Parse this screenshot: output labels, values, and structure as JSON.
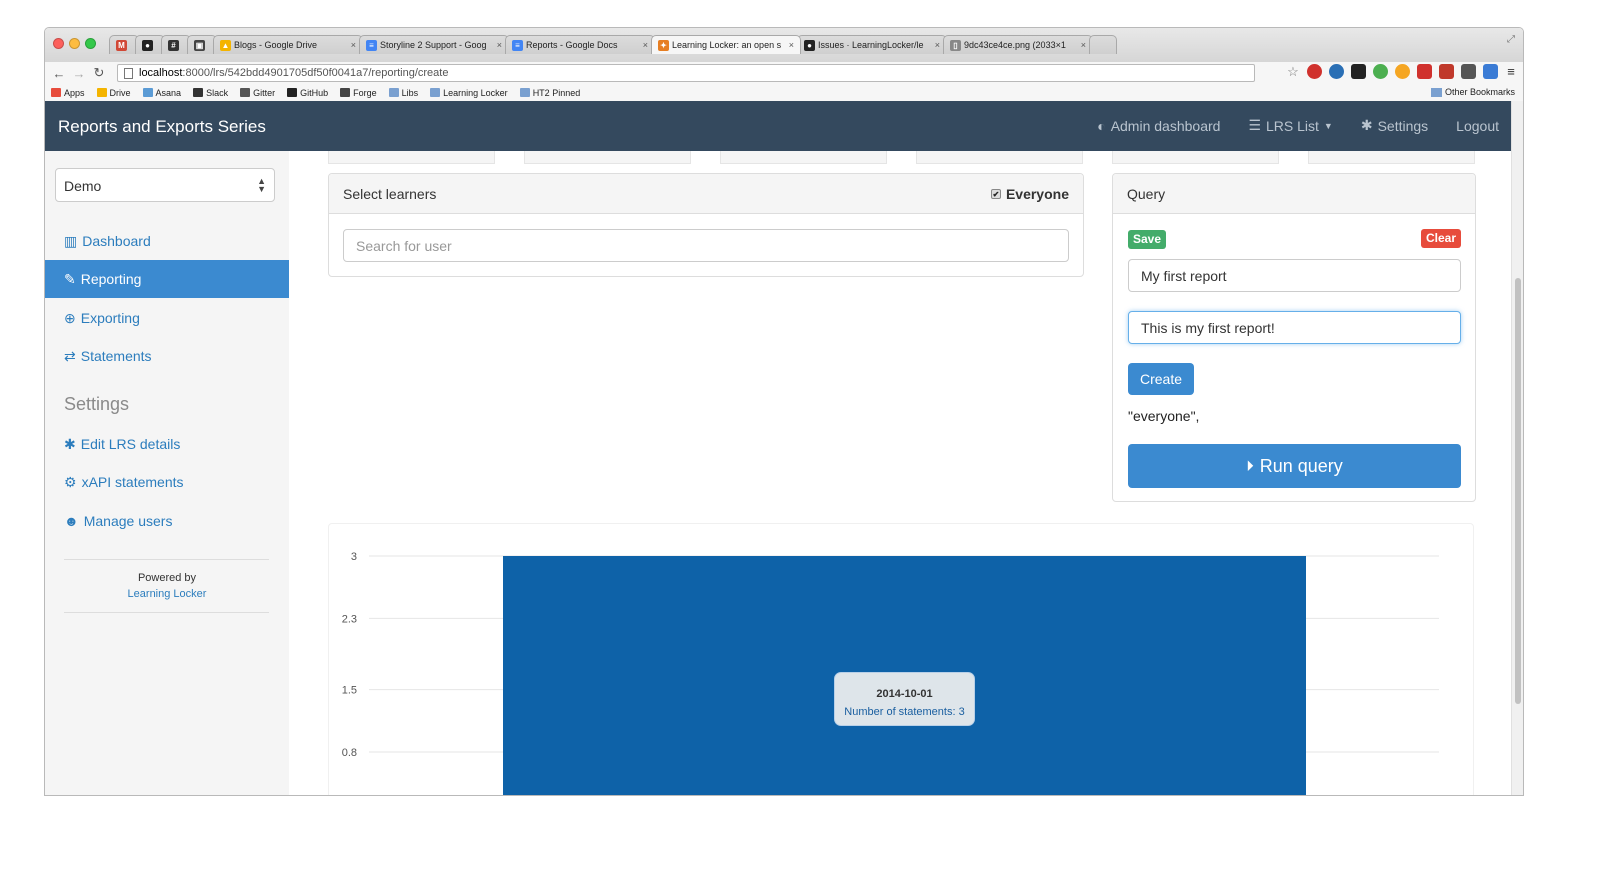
{
  "browser": {
    "tabs": [
      {
        "title": "",
        "favicon_color": "#d14836",
        "glyph": "M"
      },
      {
        "title": "",
        "favicon_color": "#222222",
        "glyph": "●"
      },
      {
        "title": "",
        "favicon_color": "#333333",
        "glyph": "#"
      },
      {
        "title": "",
        "favicon_color": "#444444",
        "glyph": "▣"
      },
      {
        "title": "Blogs - Google Drive",
        "favicon_color": "#f4b400",
        "glyph": "▲"
      },
      {
        "title": "Storyline 2 Support - Goog",
        "favicon_color": "#4285f4",
        "glyph": "≡"
      },
      {
        "title": "Reports - Google Docs",
        "favicon_color": "#4285f4",
        "glyph": "≡"
      },
      {
        "title": "Learning Locker: an open s",
        "favicon_color": "#e67e22",
        "glyph": "✦"
      },
      {
        "title": "Issues · LearningLocker/le",
        "favicon_color": "#222222",
        "glyph": "●"
      },
      {
        "title": "9dc43ce4ce.png (2033×1",
        "favicon_color": "#888888",
        "glyph": "▯"
      }
    ],
    "url_host": "localhost",
    "url_path": ":8000/lrs/542bdd4901705df50f0041a7/reporting/create",
    "bookmarks": [
      "Apps",
      "Drive",
      "Asana",
      "Slack",
      "Gitter",
      "GitHub",
      "Forge",
      "Libs",
      "Learning Locker",
      "HT2 Pinned"
    ],
    "other_bookmarks": "Other Bookmarks"
  },
  "navbar": {
    "brand": "Reports and Exports Series",
    "links": [
      {
        "icon": "dashboard-icon",
        "label": "Admin dashboard"
      },
      {
        "icon": "list-icon",
        "label": "LRS List"
      },
      {
        "icon": "gear-icon",
        "label": "Settings"
      },
      {
        "icon": "",
        "label": "Logout"
      }
    ]
  },
  "sidebar": {
    "lrs_selected": "Demo",
    "items": [
      {
        "label": "Dashboard",
        "icon": "chart-icon"
      },
      {
        "label": "Reporting",
        "icon": "pencil-icon"
      },
      {
        "label": "Exporting",
        "icon": "circle-arrow-icon"
      },
      {
        "label": "Statements",
        "icon": "swap-icon"
      }
    ],
    "settings_heading": "Settings",
    "settings_items": [
      {
        "label": "Edit LRS details",
        "icon": "gear-icon"
      },
      {
        "label": "xAPI statements",
        "icon": "gears-icon"
      },
      {
        "label": "Manage users",
        "icon": "users-icon"
      }
    ],
    "powered_by": "Powered by",
    "powered_link": "Learning Locker"
  },
  "learners": {
    "title": "Select learners",
    "everyone_label": "Everyone",
    "everyone_checked": true,
    "search_placeholder": "Search for user"
  },
  "query": {
    "title": "Query",
    "save_label": "Save",
    "clear_label": "Clear",
    "name_value": "My first report",
    "description_value": "This is my first report!",
    "create_label": "Create",
    "query_text": "\"everyone\",",
    "run_label": "Run query"
  },
  "chart_data": {
    "type": "bar",
    "categories": [
      "2014-10-01"
    ],
    "values": [
      3
    ],
    "yticks": [
      0.8,
      1.5,
      2.3,
      3
    ],
    "ylim": [
      0,
      3
    ],
    "bar_color": "#0e62a8",
    "grid": true,
    "tooltip": {
      "date": "2014-10-01",
      "label": "Number of statements: 3"
    }
  },
  "colors": {
    "navbar": "#34495e",
    "accent": "#3b8ad0",
    "save": "#43ac6a",
    "clear": "#e74c3c"
  }
}
